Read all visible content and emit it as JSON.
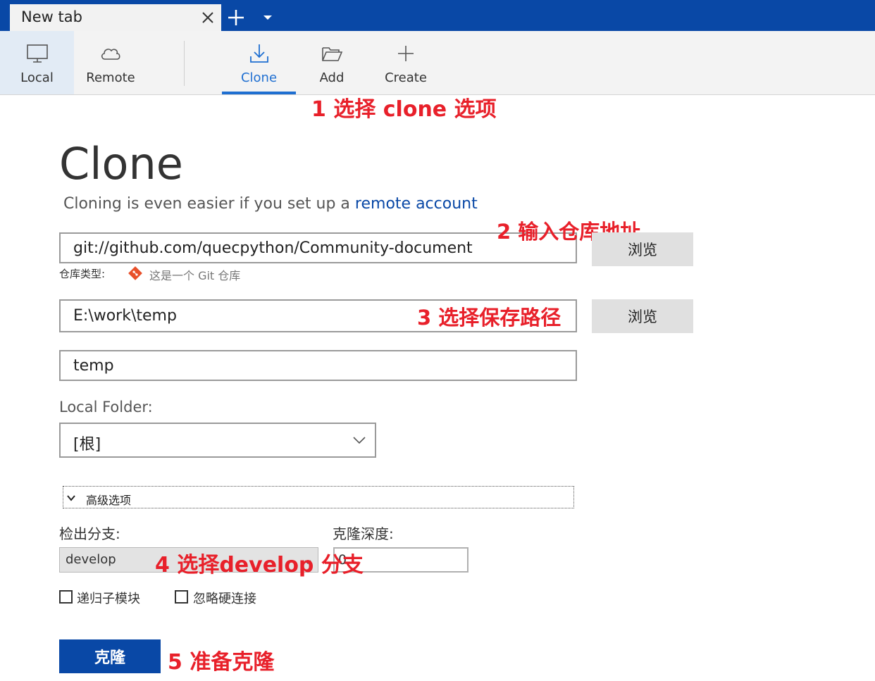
{
  "tab": {
    "title": "New tab"
  },
  "toolbar": {
    "local": "Local",
    "remote": "Remote",
    "clone": "Clone",
    "add": "Add",
    "create": "Create"
  },
  "annotations": {
    "a1": "1 选择 clone 选项",
    "a2": "2 输入仓库地址",
    "a3": "3 选择保存路径",
    "a4": "4 选择develop 分支",
    "a5": "5 准备克隆",
    "color": "#e8202a"
  },
  "clone": {
    "title": "Clone",
    "subtitle_prefix": "Cloning is even easier if you set up a ",
    "subtitle_link": "remote account",
    "repo_url": "git://github.com/quecpython/Community-document",
    "browse": "浏览",
    "repo_type_label": "仓库类型:",
    "repo_type_value": "这是一个 Git 仓库",
    "dest_path": "E:\\work\\temp",
    "name": "temp",
    "local_folder_label": "Local Folder:",
    "local_folder_value": "[根]",
    "advanced_label": "高级选项",
    "branch_label": "检出分支:",
    "depth_label": "克隆深度:",
    "branch_value": "develop",
    "depth_value": "0",
    "recursive_label": "递归子模块",
    "ignore_hardlinks_label": "忽略硬连接",
    "clone_button": "克隆"
  },
  "colors": {
    "accent": "#0948a6",
    "selected_tab": "#1f6fd1"
  }
}
